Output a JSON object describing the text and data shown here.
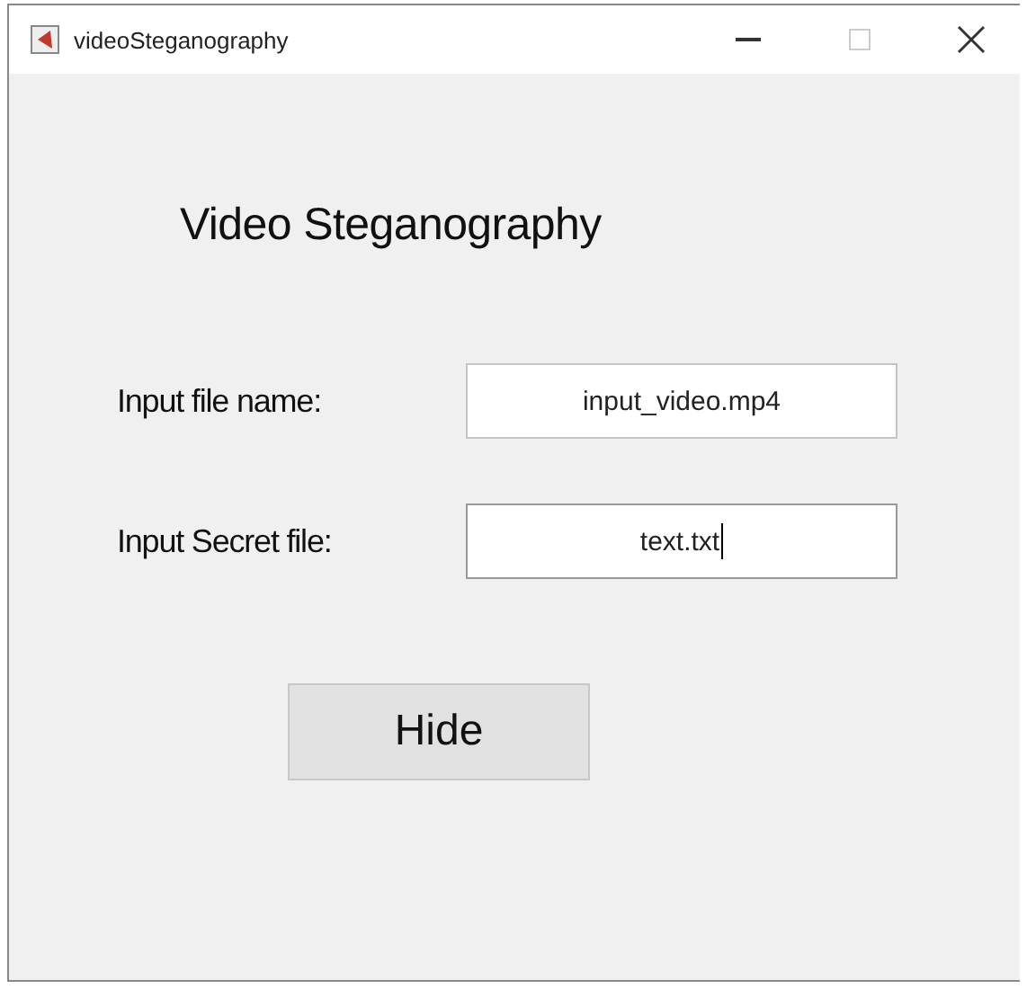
{
  "window": {
    "title": "videoSteganography"
  },
  "heading": "Video Steganography",
  "fields": [
    {
      "label": "Input file name:",
      "value": "input_video.mp4",
      "focused": false
    },
    {
      "label": "Input Secret file:",
      "value": "text.txt",
      "focused": true
    }
  ],
  "button": "Hide"
}
